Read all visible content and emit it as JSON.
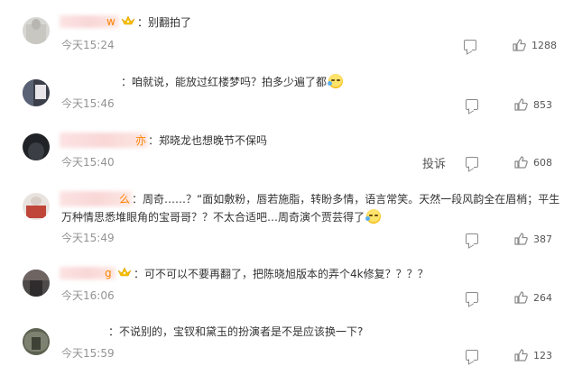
{
  "comments": [
    {
      "username": "w",
      "has_crown": true,
      "text": "别翻拍了",
      "emoji": false,
      "text2": "",
      "time": "今天15:24",
      "likes": "1288",
      "report": ""
    },
    {
      "username": "",
      "has_crown": false,
      "text": "咱就说，能放过红楼梦吗？拍多少遍了都",
      "emoji": true,
      "text2": "",
      "time": "今天15:46",
      "likes": "853",
      "report": ""
    },
    {
      "username": "亦",
      "has_crown": false,
      "text": "郑晓龙也想晚节不保吗",
      "emoji": false,
      "text2": "",
      "time": "今天15:40",
      "likes": "608",
      "report": "投诉"
    },
    {
      "username": "么",
      "has_crown": false,
      "text": "周奇……？“面如敷粉，唇若施脂，转盼多情，语言常笑。天然一段风韵全在眉梢；平生",
      "emoji": false,
      "text2": "万种情思悉堆眼角的宝哥哥？？不太合适吧…周奇演个贾芸得了",
      "time": "今天15:49",
      "likes": "387",
      "report": ""
    },
    {
      "username": "g",
      "has_crown": true,
      "text": "可不可以不要再翻了，把陈晓旭版本的弄个4k修复？？？？",
      "emoji": false,
      "text2": "",
      "time": "今天16:06",
      "likes": "264",
      "report": ""
    },
    {
      "username": "",
      "has_crown": false,
      "text": "不说别的，宝钗和黛玉的扮演者是不是应该换一下?",
      "emoji": false,
      "text2": "",
      "time": "今天15:59",
      "likes": "123",
      "report": ""
    }
  ],
  "colors": {
    "username": "#ff8200",
    "time": "#939393",
    "text": "#333333"
  }
}
